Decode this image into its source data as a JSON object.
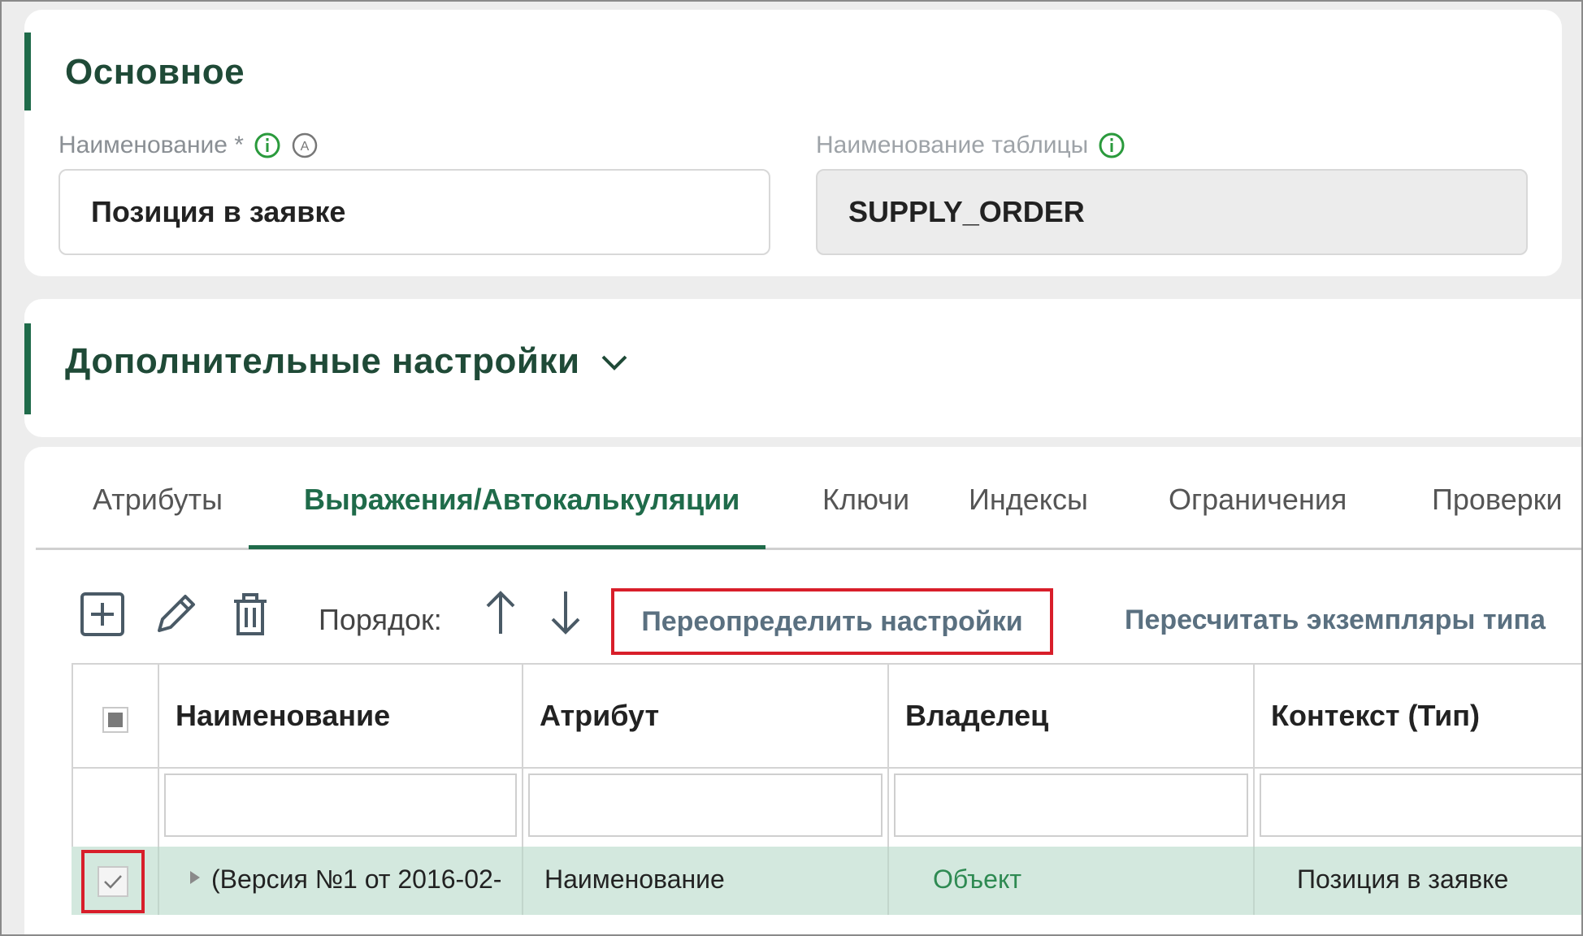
{
  "basic": {
    "title": "Основное",
    "name_label": "Наименование *",
    "name_value": "Позиция в заявке",
    "table_label": "Наименование таблицы",
    "table_value": "SUPPLY_ORDER"
  },
  "extra": {
    "title": "Дополнительные настройки"
  },
  "tabs": [
    {
      "label": "Атрибуты"
    },
    {
      "label": "Выражения/Автокалькуляции",
      "active": true
    },
    {
      "label": "Ключи"
    },
    {
      "label": "Индексы"
    },
    {
      "label": "Ограничения"
    },
    {
      "label": "Проверки"
    }
  ],
  "toolbar": {
    "order_label": "Порядок:",
    "override_link": "Переопределить настройки",
    "recalc_link": "Пересчитать экземпляры типа"
  },
  "table": {
    "columns": [
      "Наименование",
      "Атрибут",
      "Владелец",
      "Контекст (Тип)"
    ],
    "rows": [
      {
        "name": "(Версия №1 от 2016-02-",
        "attribute": "Наименование",
        "owner": "Объект",
        "context": "Позиция в заявке",
        "checked": true
      }
    ]
  },
  "colors": {
    "accent": "#1f6b4a",
    "highlight_border": "#d81e2a",
    "selected_row": "#d3e8de"
  },
  "icons": [
    "info-icon",
    "auto-icon",
    "chevron-down-icon",
    "add-icon",
    "edit-icon",
    "delete-icon",
    "arrow-up-icon",
    "arrow-down-icon",
    "checkbox-icon"
  ]
}
